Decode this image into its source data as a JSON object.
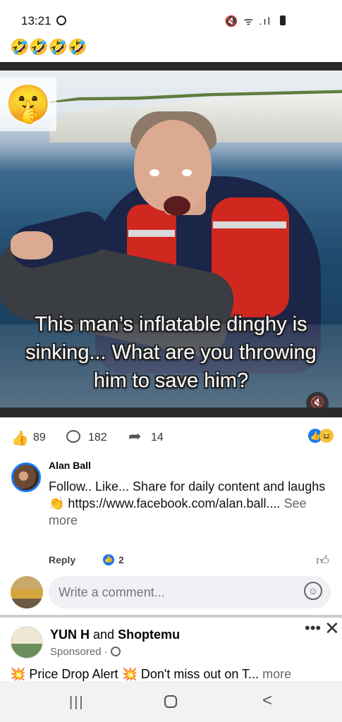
{
  "status_bar": {
    "time": "13:21",
    "icons": "🔇 ᯤ .ıl"
  },
  "post": {
    "emojis": "🤣🤣🤣🤣",
    "overlay_emoji": "🤫",
    "caption": "This man’s inflatable dinghy is sinking... What are you throwing him to save him?",
    "mute_icon": "🔇"
  },
  "reactions": {
    "likes": "89",
    "comments": "182",
    "shares": "14"
  },
  "comment": {
    "author": "Alan Ball",
    "text": "Follow.. Like... Share for daily content and laughs 👏 https://www.facebook.com/alan.ball....",
    "see_more": "See more",
    "reply": "Reply",
    "like_count": "2"
  },
  "composer": {
    "placeholder": "Write a comment..."
  },
  "ad": {
    "advertiser1": "YUN H",
    "and": " and ",
    "advertiser2": "Shoptemu",
    "sponsored": "Sponsored ·",
    "text": "💥 Price Drop Alert 💥 Don't miss out on T...",
    "more": "more"
  },
  "nav": {
    "recents": "|||",
    "back": "<"
  }
}
